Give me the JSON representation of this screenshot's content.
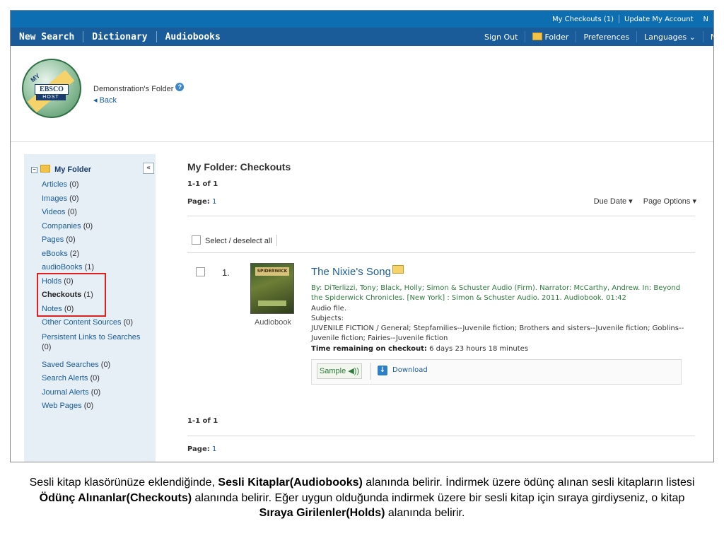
{
  "util_nav": {
    "my_checkouts": "My Checkouts (1)",
    "update_account": "Update My Account",
    "overflow": "N"
  },
  "main_nav": {
    "new_search": "New Search",
    "dictionary": "Dictionary",
    "audiobooks": "Audiobooks",
    "sign_out": "Sign Out",
    "folder": "Folder",
    "preferences": "Preferences",
    "languages": "Languages",
    "new": "Nev"
  },
  "header": {
    "logo_my": "MY",
    "logo_ebsco": "EBSCO",
    "logo_host": "HOST",
    "folder_title": "Demonstration's Folder",
    "back": "Back"
  },
  "sidebar": {
    "title": "My Folder",
    "collapse": "«",
    "items": [
      {
        "label": "Articles",
        "count": "(0)"
      },
      {
        "label": "Images",
        "count": "(0)"
      },
      {
        "label": "Videos",
        "count": "(0)"
      },
      {
        "label": "Companies",
        "count": "(0)"
      },
      {
        "label": "Pages",
        "count": "(0)"
      },
      {
        "label": "eBooks",
        "count": "(2)"
      },
      {
        "label": "audioBooks",
        "count": "(1)"
      },
      {
        "label": "Holds",
        "count": "(0)"
      },
      {
        "label": "Checkouts",
        "count": "(1)"
      },
      {
        "label": "Notes",
        "count": "(0)"
      },
      {
        "label": "Other Content Sources",
        "count": "(0)"
      },
      {
        "label": "Persistent Links to Searches",
        "count": "(0)"
      },
      {
        "label": "Saved Searches",
        "count": "(0)"
      },
      {
        "label": "Search Alerts",
        "count": "(0)"
      },
      {
        "label": "Journal Alerts",
        "count": "(0)"
      },
      {
        "label": "Web Pages",
        "count": "(0)"
      }
    ]
  },
  "main": {
    "title": "My Folder: Checkouts",
    "results_count": "1-1 of 1",
    "page_label": "Page:",
    "page_number": "1",
    "sort_due": "Due Date ▾",
    "page_options": "Page Options ▾",
    "select_all": "Select / deselect all",
    "result": {
      "number": "1.",
      "cover_text": "SPIDERWICK",
      "type_label": "Audiobook",
      "title": "The Nixie's Song",
      "by_line": "By: DiTerlizzi, Tony; Black, Holly; Simon & Schuster Audio (Firm). Narrator: McCarthy, Andrew. In: Beyond the Spiderwick Chronicles. [New York] : Simon & Schuster Audio. 2011. Audiobook. 01:42",
      "audio_file": "Audio file.",
      "subjects_label": "Subjects:",
      "subjects": "JUVENILE FICTION / General; Stepfamilies--Juvenile fiction; Brothers and sisters--Juvenile fiction; Goblins--Juvenile fiction; Fairies--Juvenile fiction",
      "time_label": "Time remaining on checkout:",
      "time_value": "6 days 23 hours 18 minutes",
      "sample": "Sample ◀))",
      "download": "Download"
    }
  },
  "caption": {
    "p1": "Sesli kitap klasörünüze eklendiğinde, ",
    "b1": "Sesli Kitaplar(Audiobooks)",
    "p2": " alanında belirir. İndirmek üzere  ödünç alınan sesli kitapların listesi  ",
    "b2": "Ödünç Alınanlar(Checkouts)",
    "p3": " alanında belirir. Eğer uygun olduğunda indirmek üzere bir sesli kitap için sıraya girdiyseniz, o kitap ",
    "b3": "Sıraya Girilenler(Holds)",
    "p4": " alanında belirir."
  },
  "colors": {
    "util_bar": "#0d6fb1",
    "nav_bar": "#1a5c9a",
    "sidebar_bg": "#e6eef6",
    "highlight_box": "#e02020",
    "link": "#1a5c9a"
  }
}
